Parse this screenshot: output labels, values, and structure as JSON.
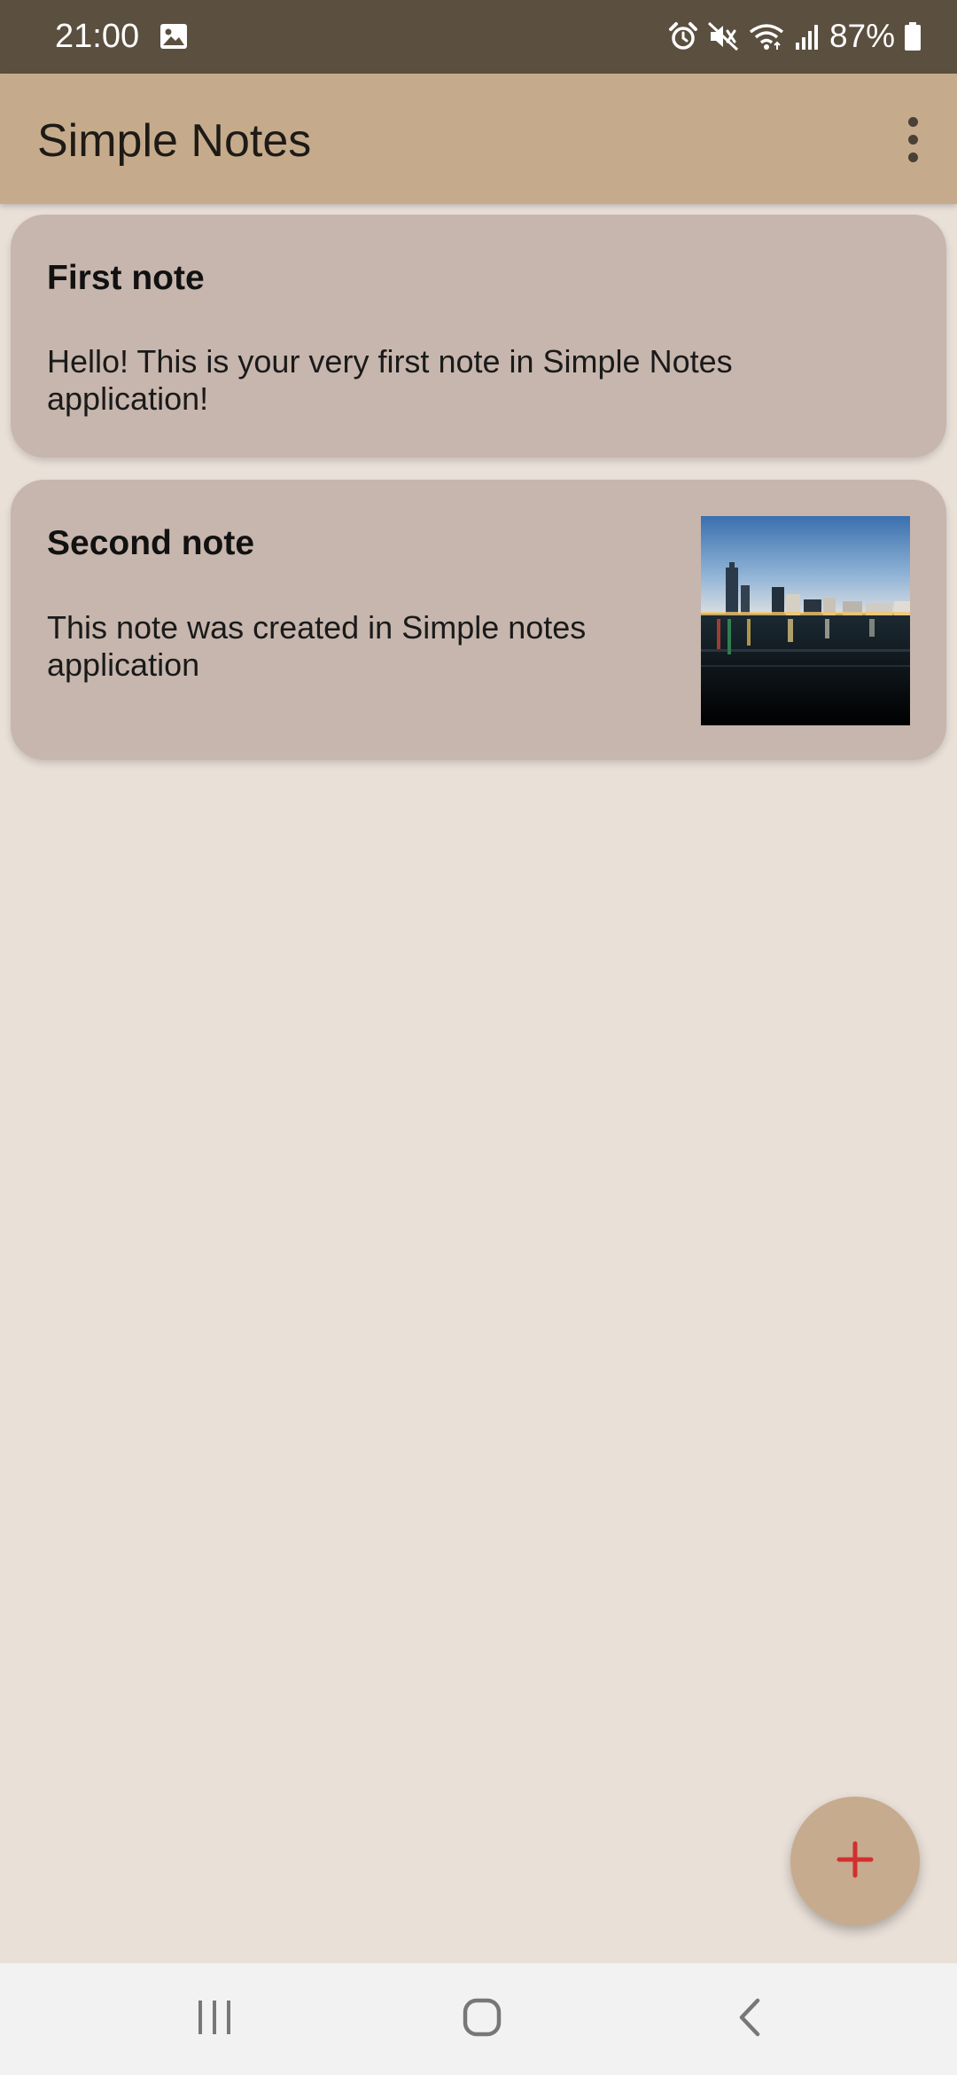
{
  "status_bar": {
    "time": "21:00",
    "battery": "87%",
    "icons": [
      "gallery-icon",
      "alarm-icon",
      "mute-icon",
      "wifi-icon",
      "signal-icon",
      "battery-icon"
    ]
  },
  "app_bar": {
    "title": "Simple Notes",
    "menu_icon": "more-vert-icon"
  },
  "notes": [
    {
      "title": "First note",
      "body": "Hello! This is your very first note in Simple Notes application!",
      "has_image": false
    },
    {
      "title": "Second note",
      "body": "This note was created in Simple notes application",
      "has_image": true,
      "image": "city-waterfront-at-dusk"
    }
  ],
  "fab": {
    "icon": "plus-icon"
  },
  "nav_bar": {
    "buttons": [
      "recents-icon",
      "home-icon",
      "back-icon"
    ]
  },
  "colors": {
    "status_bar": "#5b4f3f",
    "app_bar": "#c5ab8c",
    "background": "#e9e0d8",
    "card": "#c7b6ad",
    "fab": "#c6ab8e",
    "fab_icon": "#d32f2f",
    "nav_bar": "#f2f2f2"
  }
}
